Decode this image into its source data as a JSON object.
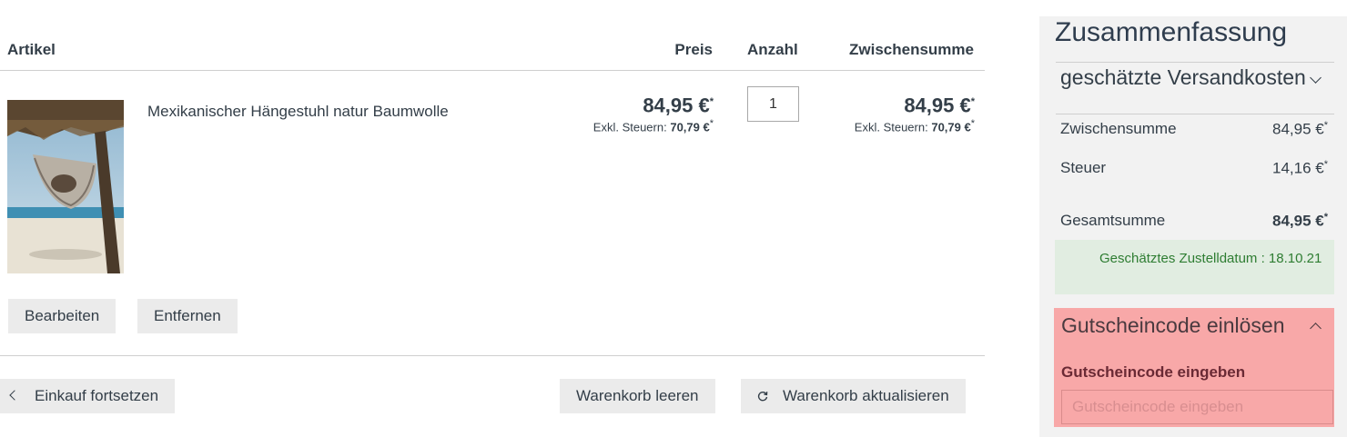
{
  "table": {
    "headers": {
      "item": "Artikel",
      "price": "Preis",
      "quantity": "Anzahl",
      "subtotal": "Zwischensumme"
    }
  },
  "item": {
    "name": "Mexikanischer Hängestuhl natur Baumwolle",
    "price": "84,95 €",
    "price_star": "*",
    "tax_label": "Exkl. Steuern:",
    "tax_value": "70,79 €",
    "quantity": "1",
    "subtotal": "84,95 €",
    "subtotal_tax_label": "Exkl. Steuern:",
    "subtotal_tax_value": "70,79 €",
    "edit_label": "Bearbeiten",
    "remove_label": "Entfernen"
  },
  "actions": {
    "continue_label": "Einkauf fortsetzen",
    "clear_label": "Warenkorb leeren",
    "update_label": "Warenkorb aktualisieren"
  },
  "summary": {
    "title": "Zusammenfassung",
    "shipping_label": "geschätzte Versandkosten",
    "rows": [
      {
        "label": "Zwischensumme",
        "value": "84,95 €"
      },
      {
        "label": "Steuer",
        "value": "14,16 €"
      },
      {
        "label": "Gesamtsumme",
        "value": "84,95 €"
      }
    ],
    "star": "*",
    "delivery": "Geschätztes Zustelldatum : 18.10.21"
  },
  "coupon": {
    "title": "Gutscheincode einlösen",
    "label": "Gutscheincode eingeben",
    "placeholder": "Gutscheincode eingeben"
  },
  "colors": {
    "text": "#333e48",
    "button_bg": "#ebebeb",
    "summary_bg": "#f2f2f2",
    "delivery_bg": "#e1ede1",
    "delivery_text": "#2e7d32",
    "coupon_highlight": "#f8a8a8"
  },
  "icons": {
    "continue": "chevron-left-icon",
    "update": "refresh-icon",
    "shipping": "chevron-down-icon",
    "coupon": "chevron-up-icon"
  }
}
